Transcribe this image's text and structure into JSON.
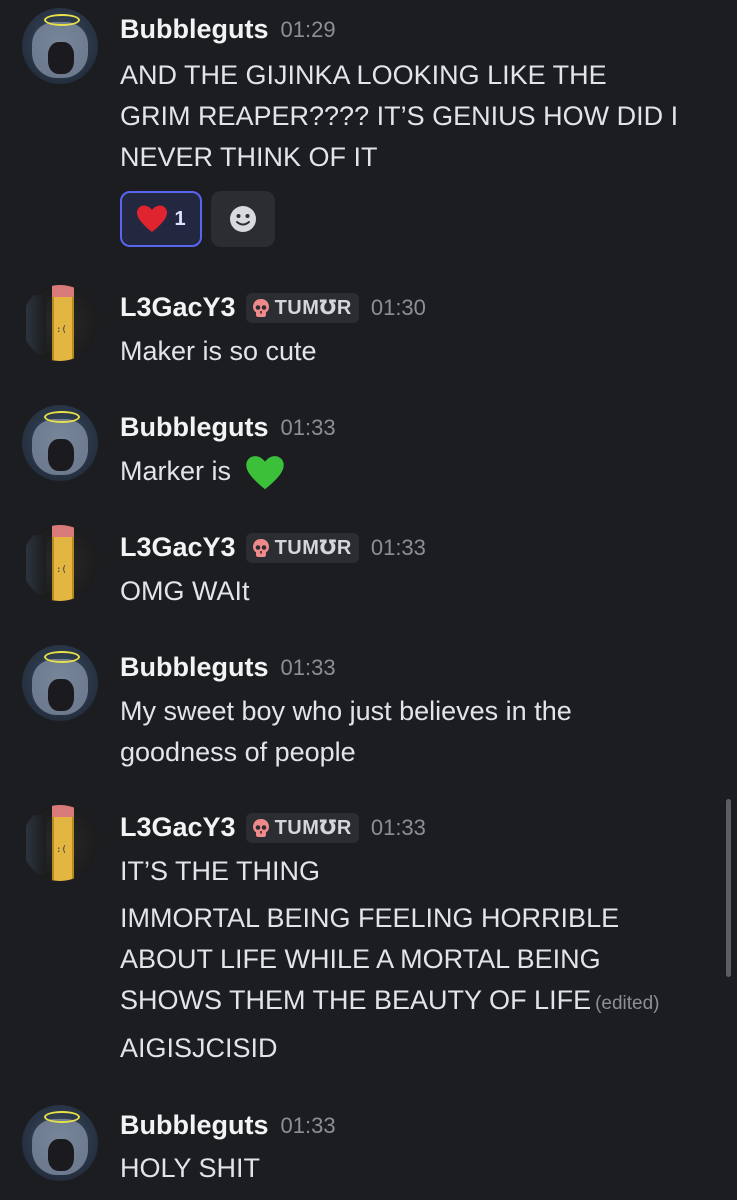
{
  "messages": [
    {
      "author": "Bubbleguts",
      "time": "01:29",
      "tag": null,
      "lines": [
        "AND THE GIJINKA LOOKING LIKE THE",
        "GRIM REAPER???? IT’S GENIUS HOW DID I",
        "NEVER THINK OF IT"
      ],
      "reaction": {
        "emoji": "heart",
        "count": "1"
      }
    },
    {
      "author": "L3GacY3",
      "time": "01:30",
      "tag": "TUM℧R",
      "lines": [
        "Maker is so cute"
      ]
    },
    {
      "author": "Bubbleguts",
      "time": "01:33",
      "tag": null,
      "lines": [
        "Marker is"
      ],
      "inline_emoji": "green-heart"
    },
    {
      "author": "L3GacY3",
      "time": "01:33",
      "tag": "TUM℧R",
      "lines": [
        "OMG WAIt"
      ]
    },
    {
      "author": "Bubbleguts",
      "time": "01:33",
      "tag": null,
      "lines": [
        "My sweet boy who just believes in the",
        "goodness of people"
      ]
    },
    {
      "author": "L3GacY3",
      "time": "01:33",
      "tag": "TUM℧R",
      "lines": [
        "IT’S THE THING",
        "IMMORTAL BEING FEELING HORRIBLE",
        "ABOUT LIFE WHILE A MORTAL BEING",
        "SHOWS THEM THE BEAUTY OF LIFE",
        "AIGISJCISID"
      ],
      "edited_label": "(edited)"
    },
    {
      "author": "Bubbleguts",
      "time": "01:33",
      "tag": null,
      "lines": [
        "HOLY SHIT"
      ]
    }
  ],
  "colors": {
    "background": "#1c1d21",
    "reaction_border": "#5865f2",
    "heart": "#e0242f",
    "green_heart": "#3cc03a"
  }
}
